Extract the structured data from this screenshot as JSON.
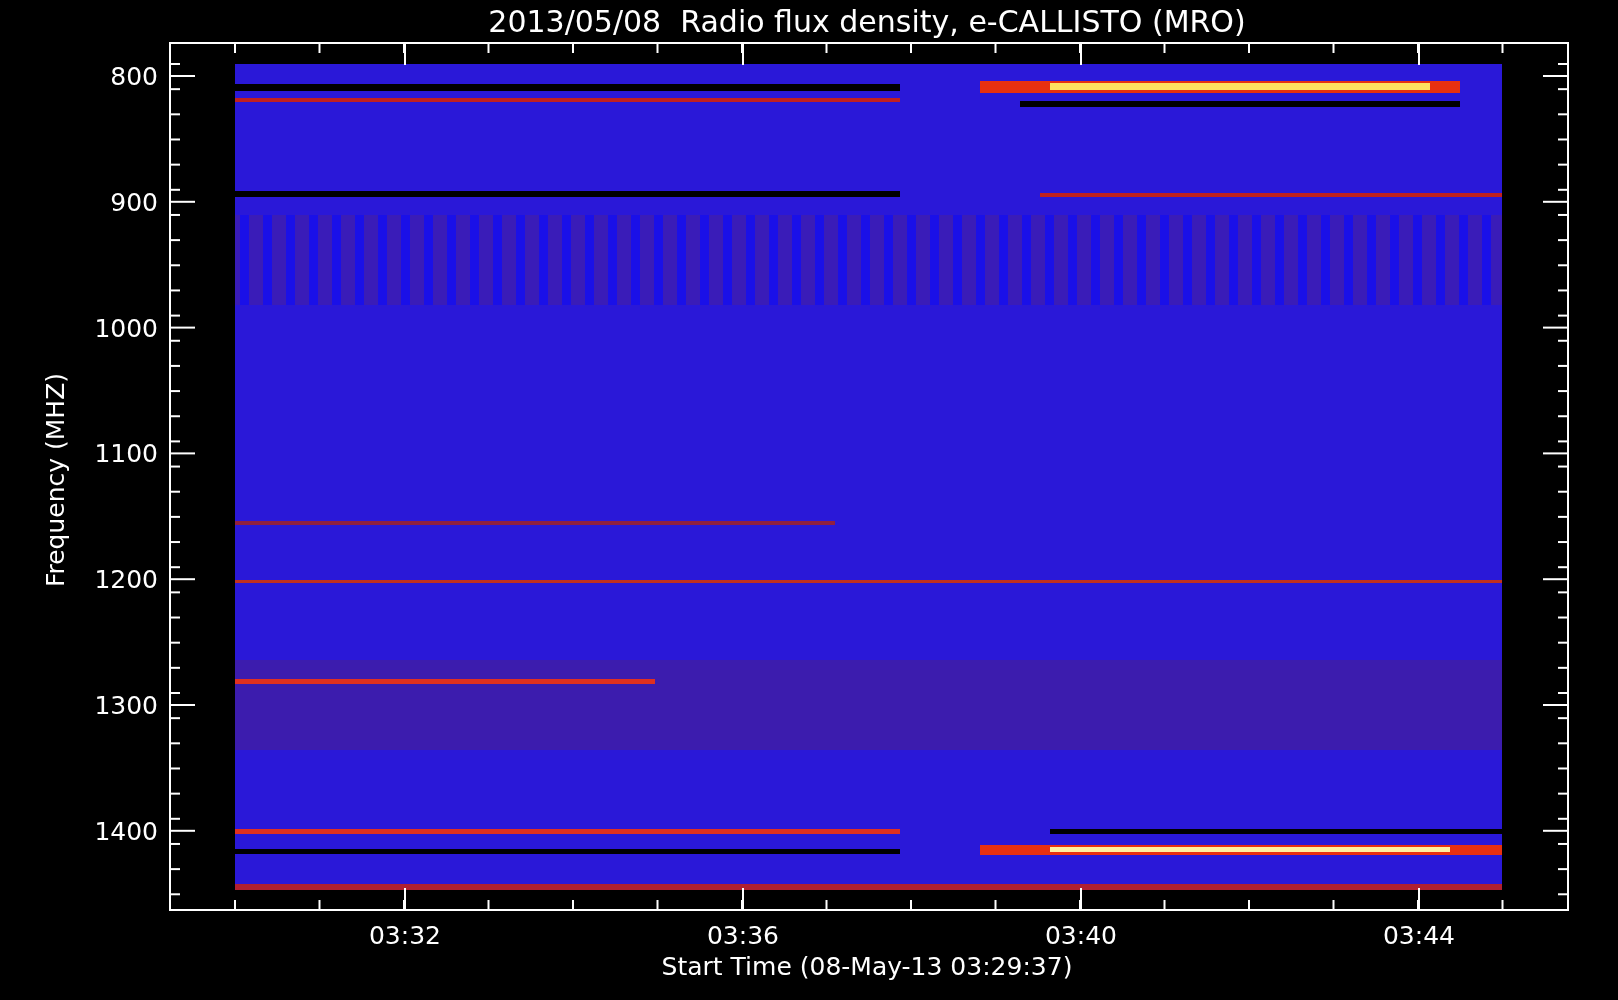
{
  "title": "2013/05/08  Radio flux density, e-CALLISTO (MRO)",
  "y_axis": {
    "label": "Frequency (MHZ)",
    "ticks": [
      "800",
      "900",
      "1000",
      "1100",
      "1200",
      "1300",
      "1400"
    ]
  },
  "x_axis": {
    "label": "Start Time (08-May-13 03:29:37)",
    "ticks": [
      "03:32",
      "03:36",
      "03:40",
      "03:44"
    ]
  }
}
